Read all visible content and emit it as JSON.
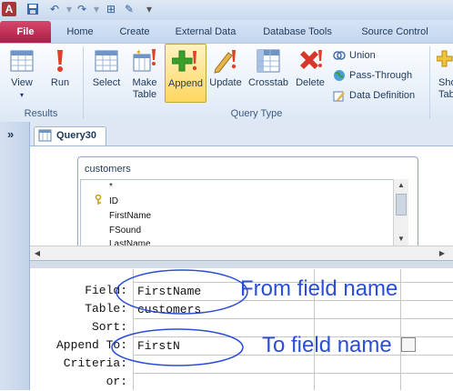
{
  "app": {
    "logo_letter": "A"
  },
  "tabs": {
    "file": "File",
    "items": [
      "Home",
      "Create",
      "External Data",
      "Database Tools",
      "Source Control"
    ]
  },
  "ribbon": {
    "results": {
      "label": "Results",
      "view": "View",
      "run": "Run"
    },
    "query_type": {
      "label": "Query Type",
      "select": "Select",
      "make_table": [
        "Make",
        "Table"
      ],
      "append": "Append",
      "update": "Update",
      "crosstab": "Crosstab",
      "delete": "Delete",
      "union": "Union",
      "pass_through": "Pass-Through",
      "data_definition": "Data Definition"
    },
    "show_partial": [
      "Sho",
      "Tab"
    ]
  },
  "document": {
    "tab_label": "Query30"
  },
  "table_box": {
    "title": "customers",
    "fields": [
      "*",
      "ID",
      "FirstName",
      "FSound",
      "LastName"
    ]
  },
  "grid": {
    "row_labels": [
      "Field:",
      "Table:",
      "Sort:",
      "Append To:",
      "Criteria:",
      "or:"
    ],
    "column1": {
      "field": "FirstName",
      "table": "customers",
      "append_to": "FirstN"
    }
  },
  "annotations": {
    "from": "From field name",
    "to": "To field name"
  },
  "colors": {
    "file_tab": "#b8284f",
    "annotation": "#2a4ed6",
    "append_highlight": "#ffd65f"
  }
}
